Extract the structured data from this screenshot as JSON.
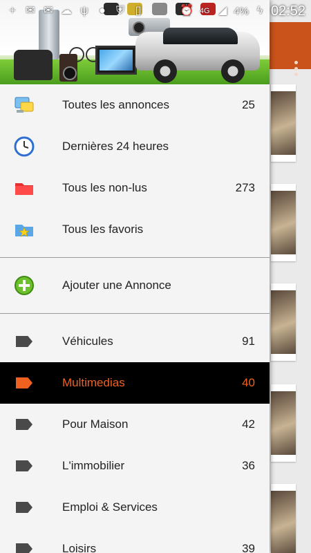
{
  "status_bar": {
    "battery_percent": "4%",
    "time": "02:52",
    "network": "4G",
    "left_icons": [
      "plus-icon",
      "mail-icon",
      "messenger-icon",
      "usb-icon",
      "app-icon",
      "shield-icon",
      "sim-icon",
      "camera-icon"
    ],
    "right_icons": [
      "alarm-icon",
      "signal-icon",
      "battery-charging-icon"
    ]
  },
  "app": {
    "toolbar_color": "#c9531a",
    "accent_color": "#f0601f",
    "overflow_icon": "overflow-menu-icon"
  },
  "drawer": {
    "header_image": "Banner image with car, TV, sofa, speakers and electronics",
    "sections": [
      {
        "items": [
          {
            "label": "Toutes les annonces",
            "count": "25",
            "icon": "list-chat-icon"
          },
          {
            "label": "Dernières 24 heures",
            "count": "",
            "icon": "clock-icon"
          },
          {
            "label": "Tous les non-lus",
            "count": "273",
            "icon": "unread-folder-icon"
          },
          {
            "label": "Tous les favoris",
            "count": "",
            "icon": "favorite-folder-icon"
          }
        ]
      },
      {
        "items": [
          {
            "label": "Ajouter une Annonce",
            "count": "",
            "icon": "add-circle-icon"
          }
        ]
      },
      {
        "items": [
          {
            "label": "Véhicules",
            "count": "91",
            "icon": "tag-icon",
            "active": false
          },
          {
            "label": "Multimedias",
            "count": "40",
            "icon": "tag-icon",
            "active": true
          },
          {
            "label": "Pour Maison",
            "count": "42",
            "icon": "tag-icon",
            "active": false
          },
          {
            "label": "L'immobilier",
            "count": "36",
            "icon": "tag-icon",
            "active": false
          },
          {
            "label": "Emploi & Services",
            "count": "",
            "icon": "tag-icon",
            "active": false
          },
          {
            "label": "Loisirs",
            "count": "39",
            "icon": "tag-icon",
            "active": false
          }
        ]
      }
    ]
  }
}
